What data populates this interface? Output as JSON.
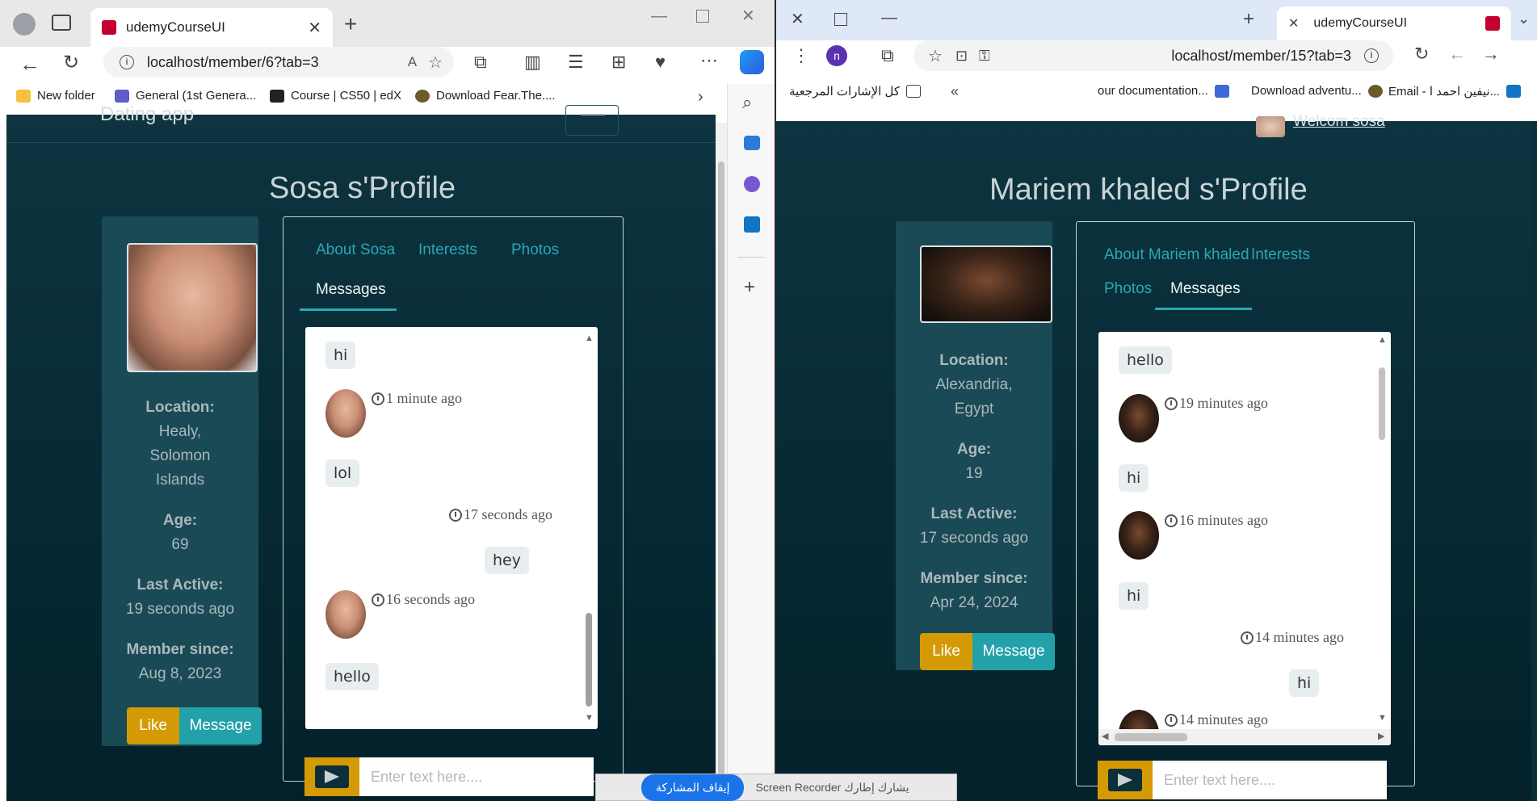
{
  "left_browser": {
    "tab_title": "udemyCourseUI",
    "url": "localhost/member/6?tab=3",
    "bookmarks": [
      "New folder",
      "General (1st Genera...",
      "Course | CS50 | edX",
      "Download Fear.The...."
    ],
    "page": {
      "brand": "Dating app",
      "profile_title": "Sosa s'Profile",
      "location_label": "Location:",
      "location_lines": [
        "Healy,",
        "Solomon",
        "Islands"
      ],
      "age_label": "Age:",
      "age": "69",
      "last_active_label": "Last Active:",
      "last_active": "19 seconds ago",
      "member_since_label": "Member since:",
      "member_since": "Aug 8, 2023",
      "like_label": "Like",
      "message_label": "Message",
      "tabs": [
        "About Sosa",
        "Interests",
        "Photos",
        "Messages"
      ],
      "messages": [
        {
          "text": "hi",
          "side": "left"
        },
        {
          "time": "1 minute ago",
          "side": "left"
        },
        {
          "text": "lol",
          "side": "left"
        },
        {
          "time": "17 seconds ago",
          "side": "right"
        },
        {
          "text": "hey",
          "side": "right"
        },
        {
          "time": "16 seconds ago",
          "side": "left"
        },
        {
          "text": "hello",
          "side": "left"
        }
      ],
      "input_placeholder": "Enter text here...."
    }
  },
  "right_browser": {
    "tab_title": "udemyCourseUI",
    "url": "localhost/member/15?tab=3",
    "profile_badge": "n",
    "bookmarks": [
      "كل الإشارات المرجعية",
      "our documentation...",
      "Download adventu...",
      "Email - نيفين احمد ا..."
    ],
    "page": {
      "welcome": "Welcom sosa",
      "profile_title": "Mariem khaled s'Profile",
      "location_label": "Location:",
      "location_lines": [
        "Alexandria,",
        "Egypt"
      ],
      "age_label": "Age:",
      "age": "19",
      "last_active_label": "Last Active:",
      "last_active": "17 seconds ago",
      "member_since_label": "Member since:",
      "member_since": "Apr 24, 2024",
      "like_label": "Like",
      "message_label": "Message",
      "tabs": [
        "About Mariem khaled",
        "Interests",
        "Photos",
        "Messages"
      ],
      "messages": [
        {
          "text": "hello",
          "side": "left"
        },
        {
          "time": "19 minutes ago",
          "side": "left"
        },
        {
          "text": "hi",
          "side": "left"
        },
        {
          "time": "16 minutes ago",
          "side": "left"
        },
        {
          "text": "hi",
          "side": "left"
        },
        {
          "time": "14 minutes ago",
          "side": "right"
        },
        {
          "text": "hi",
          "side": "right"
        },
        {
          "time": "14 minutes ago",
          "side": "left"
        }
      ],
      "input_placeholder": "Enter text here...."
    }
  },
  "recorder": {
    "stop_label": "إيقاف المشاركة",
    "status": "Screen Recorder يشارك إطارك"
  }
}
